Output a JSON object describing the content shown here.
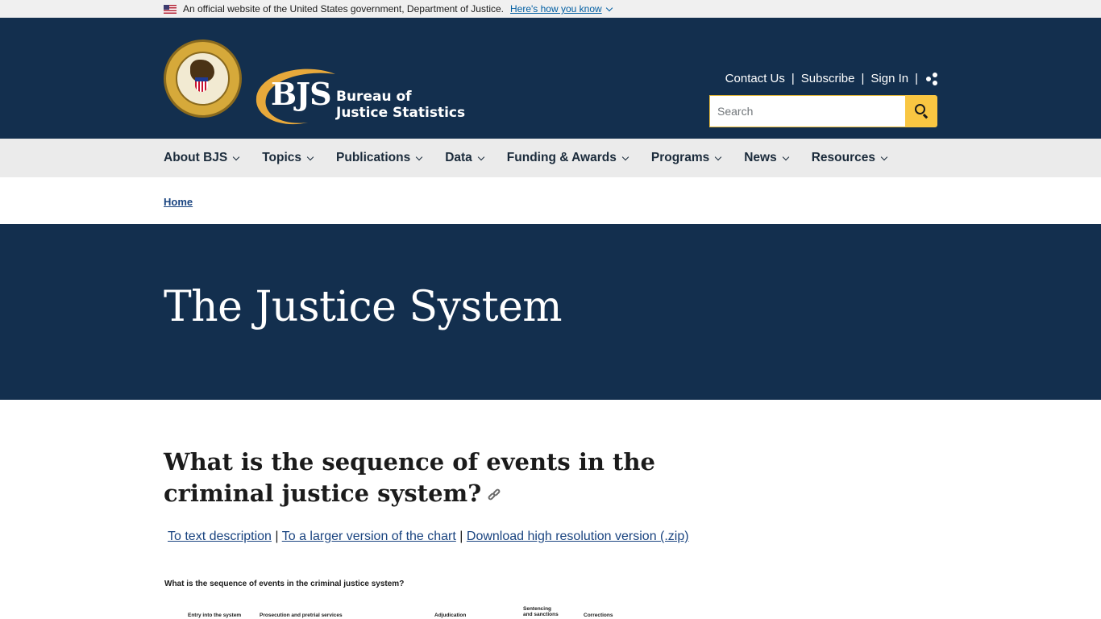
{
  "gov_banner": {
    "text": "An official website of the United States government, Department of Justice.",
    "link": "Here's how you know"
  },
  "header": {
    "logo_abbr": "BJS",
    "logo_name_line1": "Bureau of",
    "logo_name_line2": "Justice Statistics",
    "utility_links": [
      "Contact Us",
      "Subscribe",
      "Sign In"
    ],
    "search_placeholder": "Search",
    "brand_navy": "#132f4e",
    "accent_gold": "#f9c642"
  },
  "nav": {
    "items": [
      "About BJS",
      "Topics",
      "Publications",
      "Data",
      "Funding & Awards",
      "Programs",
      "News",
      "Resources"
    ]
  },
  "breadcrumb": {
    "home": "Home"
  },
  "hero": {
    "title": "The Justice System"
  },
  "content": {
    "heading": "What is the sequence of events in the criminal justice system?",
    "link_text_desc": "To text description",
    "link_larger": "To a larger version of the chart",
    "link_download": "Download high resolution version (.zip)",
    "separator": "|",
    "chart_title": "What is the sequence of events in the criminal justice system?",
    "chart_stages": [
      "Entry into the system",
      "Prosecution and pretrial services",
      "Adjudication",
      "Sentencing and sanctions",
      "Corrections"
    ]
  }
}
